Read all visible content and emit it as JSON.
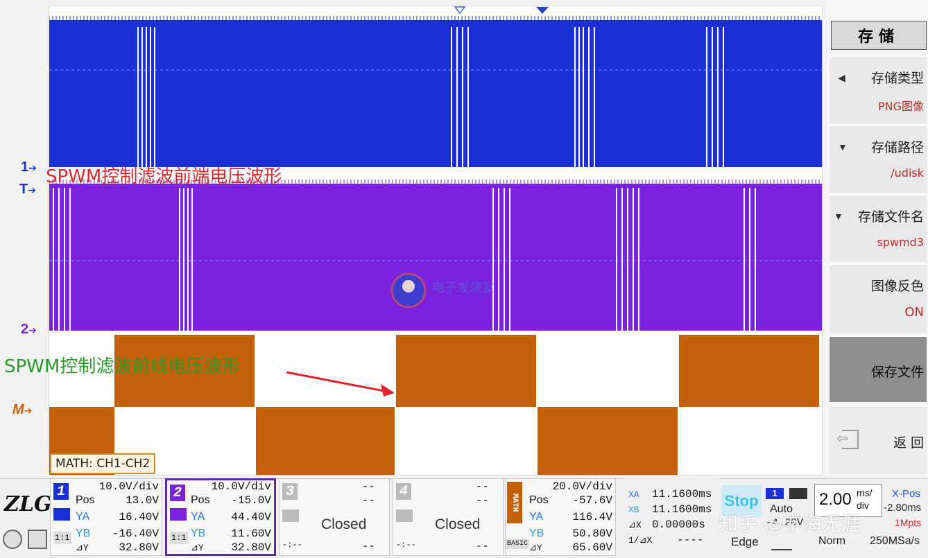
{
  "display": {
    "markers": {
      "ch1": "1",
      "trigger": "T",
      "ch2": "2",
      "math": "M"
    },
    "overlay_top": "SPWM控制滤波前端电压波形",
    "overlay_bottom": "SPWM控制滤波前线电压波形",
    "math_label": "MATH: CH1-CH2",
    "colors": {
      "ch1": "#1a2fd4",
      "ch2": "#7a22de",
      "math": "#c4600a",
      "overlay_top": "#d8282e",
      "overlay_bottom": "#2a9d2a",
      "arrow": "#e0242a"
    }
  },
  "menu": {
    "title": "存储",
    "items": [
      {
        "label": "存储类型",
        "value": "PNG图像",
        "arrow": "◀"
      },
      {
        "label": "存储路径",
        "value": "/udisk",
        "arrow": "▼"
      },
      {
        "label": "存储文件名",
        "value": "spwmd3",
        "arrow": "▼"
      },
      {
        "label": "图像反色",
        "value": "ON",
        "arrow": ""
      }
    ],
    "save_label": "保存文件",
    "back_label": "返 回"
  },
  "logo": {
    "text": "ZLG",
    "reg": "®"
  },
  "channels": {
    "ch1": {
      "num": "1",
      "div": "10.0V/div",
      "pos_label": "Pos",
      "pos": "13.0V",
      "ya_label": "YA",
      "ya": "16.40V",
      "yb_label": "YB",
      "yb": "-16.40V",
      "dy_label": "⊿Y",
      "dy": "32.80V",
      "ratio": "1:1"
    },
    "ch2": {
      "num": "2",
      "div": "10.0V/div",
      "pos_label": "Pos",
      "pos": "-15.0V",
      "ya_label": "YA",
      "ya": "44.40V",
      "yb_label": "YB",
      "yb": "11.60V",
      "dy_label": "⊿Y",
      "dy": "32.80V",
      "ratio": "1:1"
    },
    "ch3": {
      "num": "3",
      "dash1": "--",
      "dash2": "--",
      "state": "Closed",
      "dash3": "--",
      "dash4": "-:--"
    },
    "ch4": {
      "num": "4",
      "dash1": "--",
      "dash2": "--",
      "state": "Closed",
      "dash3": "--",
      "dash4": "-:--"
    },
    "math": {
      "tag": "MATH",
      "div": "20.0V/div",
      "pos_label": "Pos",
      "pos": "-57.6V",
      "ya_label": "YA",
      "ya": "116.4V",
      "yb_label": "YB",
      "yb": "50.80V",
      "dy_label": "⊿Y",
      "dy": "65.60V",
      "mode": "BASIC"
    }
  },
  "cursor": {
    "xa_label": "XA",
    "xa": "11.1600ms",
    "xb_label": "XB",
    "xb": "11.1600ms",
    "dx_label": "⊿X",
    "dx": "0.00000s",
    "inv_label": "1/⊿X",
    "inv": "----"
  },
  "trigger": {
    "state": "Stop",
    "ch": "1",
    "mode": "Auto",
    "level": "-4.20V",
    "type": "Edge"
  },
  "timebase": {
    "div_value": "2.00",
    "div_unit_top": "ms/",
    "div_unit_bot": "div",
    "xpos_label": "X-Pos",
    "xpos": "-2.80ms",
    "norm": "Norm",
    "pts": "1Mpts",
    "rate": "250MSa/s"
  },
  "watermark": {
    "text": "知乎 @学海无涯",
    "center_text": "电子发烧友"
  }
}
